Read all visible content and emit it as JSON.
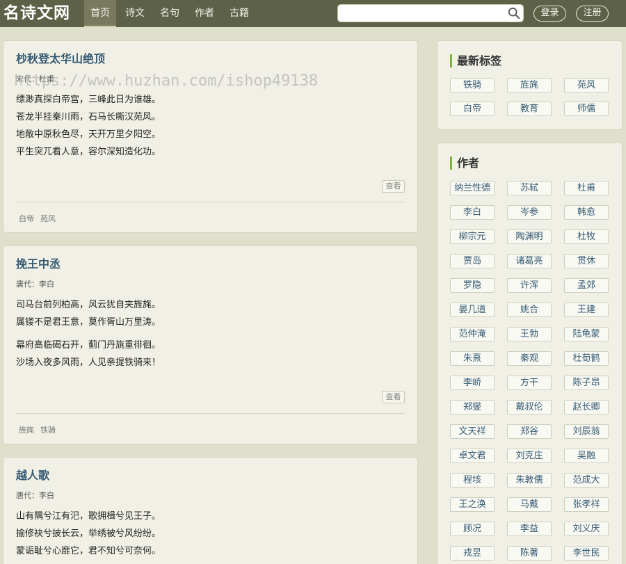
{
  "header": {
    "logo": "名诗文网",
    "nav": [
      "首页",
      "诗文",
      "名句",
      "作者",
      "古籍"
    ],
    "search_value": "",
    "search_placeholder": "",
    "login": "登录",
    "register": "注册"
  },
  "watermark": "https://www.huzhan.com/ishop49138",
  "poems": [
    {
      "title": "杪秋登太华山绝顶",
      "meta": "宋代：杜甫",
      "lines": [
        "缥渺真探白帝宫，三峰此日为谁雄。",
        "苍龙半挂秦川雨，石马长嘶汉苑风。",
        "地敞中原秋色尽，天开万里夕阳空。",
        "平生突兀看人意，容尔深知造化功。"
      ],
      "view": "查看",
      "tags": [
        "白帝",
        "苑风"
      ]
    },
    {
      "title": "挽王中丞",
      "meta": "唐代：李白",
      "lines": [
        "司马台前列柏高，风云犹自夹旌旄。",
        "属镂不是君王意，莫作胥山万里涛。"
      ],
      "lines2": [
        "幕府高临碣石开，蓟门丹旐重徘徊。",
        "沙场入夜多风雨，人见亲提铁骑来！"
      ],
      "view": "查看",
      "tags": [
        "旌旄",
        "铁骑"
      ]
    },
    {
      "title": "越人歌",
      "meta": "唐代：李白",
      "lines": [
        "山有隅兮江有汜，歌拥楫兮见王子。",
        "揄修袂兮披长云，举绣被兮风纷纷。",
        "蒙诟耻兮心靡它，君不知兮可奈何。"
      ]
    }
  ],
  "sidebar": {
    "tags_title": "最新标签",
    "tags": [
      "铁骑",
      "旌旄",
      "苑风",
      "白帝",
      "教育",
      "师儒"
    ],
    "authors_title": "作者",
    "authors": [
      "纳兰性德",
      "苏轼",
      "杜甫",
      "李白",
      "岑参",
      "韩愈",
      "柳宗元",
      "陶渊明",
      "杜牧",
      "贾岛",
      "诸葛亮",
      "贯休",
      "罗隐",
      "许浑",
      "孟郊",
      "晏几道",
      "姚合",
      "王建",
      "范仲淹",
      "王勃",
      "陆龟蒙",
      "朱熹",
      "秦观",
      "杜荀鹤",
      "李峤",
      "方干",
      "陈子昂",
      "郑燮",
      "戴叔伦",
      "赵长卿",
      "文天祥",
      "郑谷",
      "刘辰翁",
      "卓文君",
      "刘克庄",
      "吴融",
      "程垓",
      "朱敦儒",
      "范成大",
      "王之涣",
      "马戴",
      "张孝祥",
      "顾况",
      "李益",
      "刘义庆",
      "戎昱",
      "陈著",
      "李世民"
    ]
  }
}
